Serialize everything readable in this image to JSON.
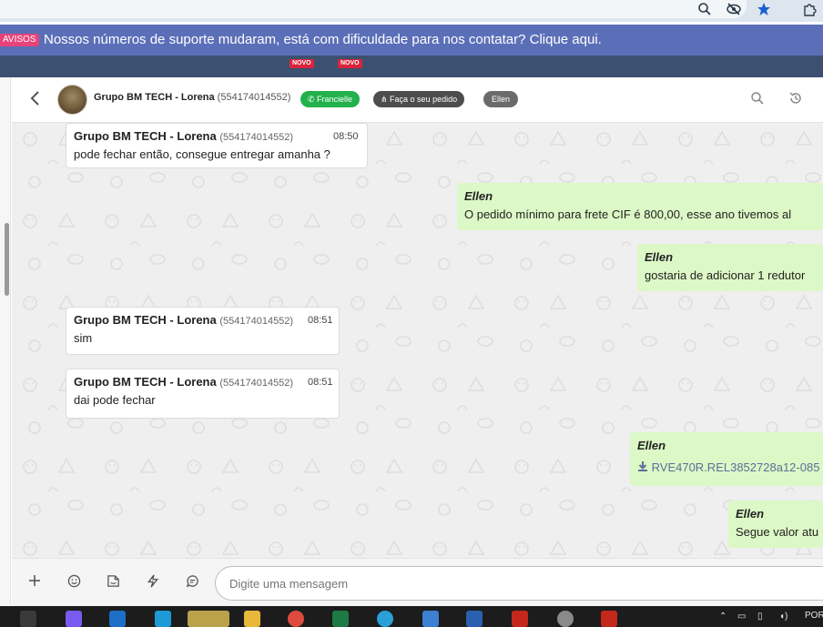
{
  "browser": {
    "icons": [
      "zoom-icon",
      "eye-off-icon",
      "star-icon",
      "extensions-icon"
    ]
  },
  "notice": {
    "tag": "AVISOS",
    "message": "Nossos números de suporte mudaram, está com dificuldade para nos contatar? Clique aqui."
  },
  "nav_stripe": {
    "badges": [
      "NOVO",
      "NOVO"
    ]
  },
  "header": {
    "contact_name": "Grupo BM TECH - Lorena",
    "contact_phone": "(554174014552)",
    "tag_agent": "Francielle",
    "tag_order": "Faça o seu pedido",
    "tag_user": "Ellen"
  },
  "messages": {
    "m1": {
      "sender": "Grupo BM TECH - Lorena",
      "phone": "(554174014552)",
      "time": "08:50",
      "text": "pode fechar então, consegue entregar amanha ?"
    },
    "m2": {
      "author": "Ellen",
      "text": "O pedido mínimo para frete CIF é 800,00, esse ano tivemos al"
    },
    "m3": {
      "author": "Ellen",
      "text": "gostaria de adicionar 1 redutor"
    },
    "m4": {
      "sender": "Grupo BM TECH - Lorena",
      "phone": "(554174014552)",
      "time": "08:51",
      "text": "sim"
    },
    "m5": {
      "sender": "Grupo BM TECH - Lorena",
      "phone": "(554174014552)",
      "time": "08:51",
      "text": "dai pode fechar"
    },
    "m6": {
      "author": "Ellen",
      "file": "RVE470R.REL3852728a12-085"
    },
    "m7": {
      "author": "Ellen",
      "text": "Segue valor atu"
    }
  },
  "composer": {
    "placeholder": "Digite uma mensagem"
  },
  "taskbar": {
    "tray_text": "POR"
  },
  "colors": {
    "notice_bg": "#5b6fb8",
    "notice_tag": "#e8427a",
    "outgoing_bubble": "#dcf8c6",
    "agent_pill": "#22b14c",
    "chat_bg": "#efefef"
  }
}
